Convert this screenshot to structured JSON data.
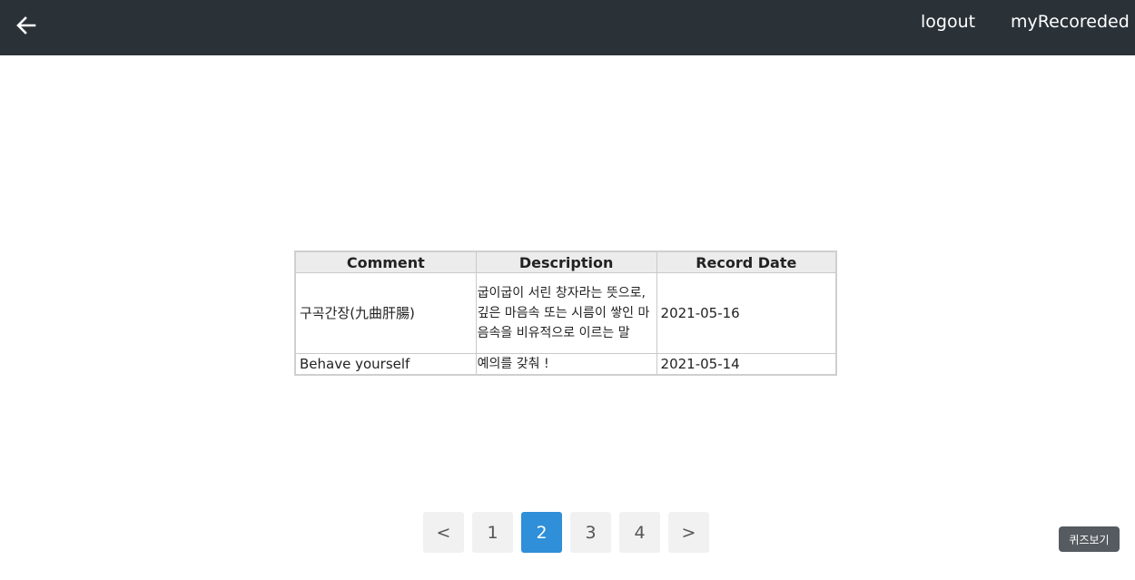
{
  "header": {
    "back_icon": "arrow-left-icon",
    "logout_label": "logout",
    "my_recorded_label": "myRecoreded"
  },
  "table": {
    "columns": [
      "Comment",
      "Description",
      "Record Date"
    ],
    "rows": [
      {
        "comment": "구곡간장(九曲肝腸)",
        "description": " 굽이굽이 서린 창자라는 뜻으로, 깊은 마음속 또는 시름이 쌓인 마음속을 비유적으로 이르는 말",
        "record_date": "2021-05-16"
      },
      {
        "comment": "Behave yourself",
        "description": " 예의를 갖춰 !",
        "record_date": "2021-05-14"
      }
    ]
  },
  "pagination": {
    "prev_label": "<",
    "pages": [
      "1",
      "2",
      "3",
      "4"
    ],
    "current_page": "2",
    "next_label": ">"
  },
  "quiz_button_label": "퀴즈보기",
  "colors": {
    "topbar": "#2a3238",
    "active_page": "#2f8fd8",
    "quiz_button": "#555b60"
  }
}
